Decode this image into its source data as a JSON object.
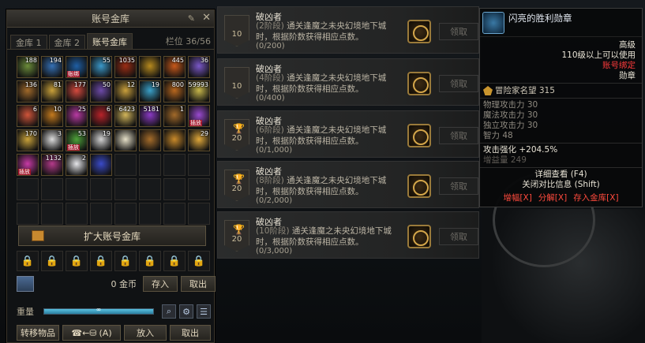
{
  "storage": {
    "title": "账号金库",
    "tabs": [
      {
        "label": "金库 1",
        "active": false
      },
      {
        "label": "金库 2",
        "active": false
      },
      {
        "label": "账号金库",
        "active": true
      }
    ],
    "capacity_label": "栏位",
    "capacity_value": "36/56",
    "slots": [
      {
        "qty": "188",
        "color": "#6b8c3a",
        "tag": ""
      },
      {
        "qty": "194",
        "color": "#3570b5",
        "tag": ""
      },
      {
        "qty": "",
        "color": "#1f5fa5",
        "tag": "账绑"
      },
      {
        "qty": "55",
        "color": "#3b98c9",
        "tag": ""
      },
      {
        "qty": "1035",
        "color": "#9b2d14",
        "tag": ""
      },
      {
        "qty": "",
        "color": "#b78a1e",
        "tag": ""
      },
      {
        "qty": "445",
        "color": "#c8591a",
        "tag": ""
      },
      {
        "qty": "36",
        "color": "#7a58c8",
        "tag": ""
      },
      {
        "qty": "136",
        "color": "#a0692a",
        "tag": ""
      },
      {
        "qty": "81",
        "color": "#c9a13a",
        "tag": ""
      },
      {
        "qty": "177",
        "color": "#d54a3e",
        "tag": ""
      },
      {
        "qty": "50",
        "color": "#6d4aa8",
        "tag": ""
      },
      {
        "qty": "12",
        "color": "#caa03c",
        "tag": ""
      },
      {
        "qty": "19",
        "color": "#3aa0c8",
        "tag": ""
      },
      {
        "qty": "800",
        "color": "#b8671e",
        "tag": ""
      },
      {
        "qty": "59993",
        "color": "#c6b64a",
        "tag": ""
      },
      {
        "qty": "6",
        "color": "#d0553a",
        "tag": ""
      },
      {
        "qty": "10",
        "color": "#c47a1e",
        "tag": ""
      },
      {
        "qty": "25",
        "color": "#b83aa3",
        "tag": ""
      },
      {
        "qty": "6",
        "color": "#b8232a",
        "tag": ""
      },
      {
        "qty": "6423",
        "color": "#d2b55a",
        "tag": ""
      },
      {
        "qty": "5181",
        "color": "#8a3ac4",
        "tag": ""
      },
      {
        "qty": "1",
        "color": "#a36a2a",
        "tag": ""
      },
      {
        "qty": "",
        "color": "#9a4ad0",
        "tag": "插放"
      },
      {
        "qty": "170",
        "color": "#c9a23a",
        "tag": ""
      },
      {
        "qty": "3",
        "color": "#dcdcdc",
        "tag": ""
      },
      {
        "qty": "53",
        "color": "#4ea13a",
        "tag": "插放"
      },
      {
        "qty": "19",
        "color": "#d2d2d2",
        "tag": ""
      },
      {
        "qty": "",
        "color": "#e6e0c8",
        "tag": ""
      },
      {
        "qty": "",
        "color": "#a56c2a",
        "tag": ""
      },
      {
        "qty": "",
        "color": "#c98a2a",
        "tag": ""
      },
      {
        "qty": "29",
        "color": "#e0a83a",
        "tag": ""
      },
      {
        "qty": "",
        "color": "#c83aa6",
        "tag": "插放"
      },
      {
        "qty": "1132",
        "color": "#b43a8a",
        "tag": ""
      },
      {
        "qty": "2",
        "color": "#e6e6ea",
        "tag": ""
      },
      {
        "qty": "",
        "color": "#3a4ac8",
        "tag": ""
      }
    ],
    "expand_label": "扩大账号金库",
    "gold_amount": "0 金币",
    "deposit_label": "存入",
    "withdraw_label": "取出",
    "weight_label": "重量",
    "weight_value": "∞",
    "weight_fill_ratio": 1.0,
    "transfer_label": "转移物品",
    "shortcut_label": "(A)",
    "put_label": "放入",
    "take_label": "取出"
  },
  "achievements": [
    {
      "badge": "10",
      "trophy": false,
      "name": "破凶者",
      "stage": "(2阶段)",
      "desc": "通关逢魔之未央幻境地下城时，根据阶数获得相应点数。",
      "progress": "(0/200)",
      "claim": "领取"
    },
    {
      "badge": "10",
      "trophy": false,
      "name": "破凶者",
      "stage": "(4阶段)",
      "desc": "通关逢魔之未央幻境地下城时，根据阶数获得相应点数。",
      "progress": "(0/400)",
      "claim": "领取"
    },
    {
      "badge": "20",
      "trophy": true,
      "name": "破凶者",
      "stage": "(6阶段)",
      "desc": "通关逢魔之未央幻境地下城时，根据阶数获得相应点数。",
      "progress": "(0/1,000)",
      "claim": "领取"
    },
    {
      "badge": "20",
      "trophy": true,
      "name": "破凶者",
      "stage": "(8阶段)",
      "desc": "通关逢魔之未央幻境地下城时，根据阶数获得相应点数。",
      "progress": "(0/2,000)",
      "claim": "领取"
    },
    {
      "badge": "20",
      "trophy": true,
      "name": "破凶者",
      "stage": "(10阶段)",
      "desc": "通关逢魔之未央幻境地下城时，根据阶数获得相应点数。",
      "progress": "(0/3,000)",
      "claim": "领取"
    }
  ],
  "tooltip": {
    "name": "闪亮的胜利勋章",
    "grade": "高级",
    "level_req": "110级以上可以使用",
    "bind": "账号绑定",
    "type": "勋章",
    "reputation": "冒险家名望 315",
    "stats": [
      "物理攻击力 30",
      "魔法攻击力 30",
      "独立攻击力 30",
      "智力 48"
    ],
    "attack_boost": "攻击强化 +204.5%",
    "amplify": "增益量 249",
    "detail": "详细查看 (F4)",
    "compare": "关闭对比信息 (Shift)",
    "actions": [
      "增幅[X]",
      "分解[X]",
      "存入金库[X]"
    ]
  }
}
